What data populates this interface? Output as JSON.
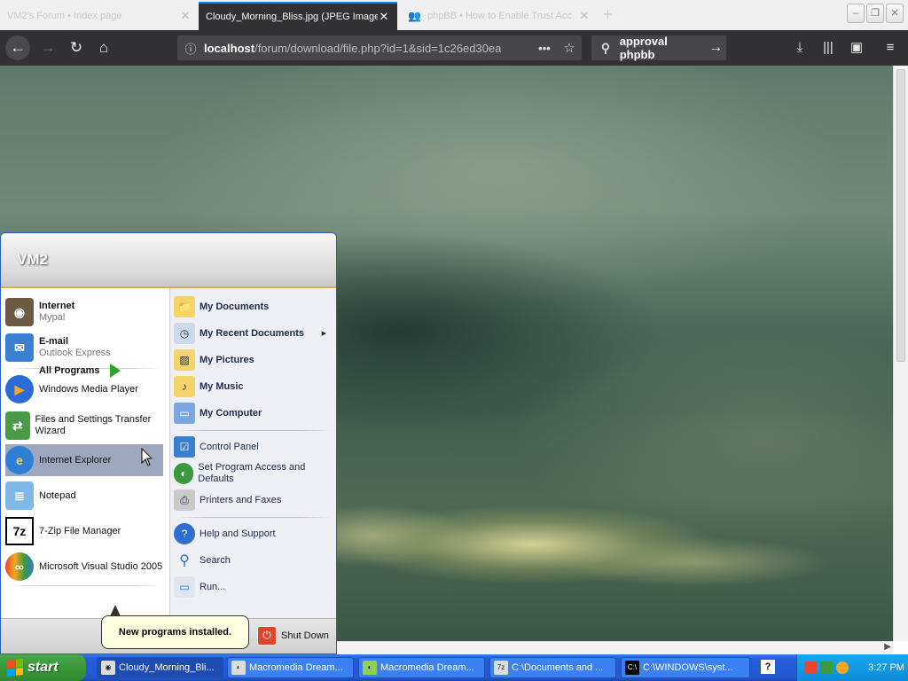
{
  "browser": {
    "tabs": [
      {
        "title": "VM2's Forum • Index page",
        "active": false
      },
      {
        "title": "Cloudy_Morning_Bliss.jpg (JPEG Image",
        "active": true
      },
      {
        "title": "phpBB • How to Enable Trust Acc",
        "active": false
      }
    ],
    "url_host": "localhost",
    "url_path": "/forum/download/file.php?id=1&sid=1c26ed30ea",
    "search_text": "approval phpbb"
  },
  "start_menu": {
    "user_name": "VM2",
    "pinned": [
      {
        "title": "Internet",
        "subtitle": "Mypal"
      },
      {
        "title": "E-mail",
        "subtitle": "Outlook Express"
      }
    ],
    "recent": [
      {
        "label": "Windows Media Player"
      },
      {
        "label": "Files and Settings Transfer Wizard"
      },
      {
        "label": "Internet Explorer"
      },
      {
        "label": "Notepad"
      },
      {
        "label": "7-Zip File Manager"
      },
      {
        "label": "Microsoft Visual Studio 2005"
      }
    ],
    "all_programs": "All Programs",
    "places": [
      {
        "label": "My Documents"
      },
      {
        "label": "My Recent Documents"
      },
      {
        "label": "My Pictures"
      },
      {
        "label": "My Music"
      },
      {
        "label": "My Computer"
      }
    ],
    "system": [
      {
        "label": "Control Panel"
      },
      {
        "label": "Set Program Access and Defaults"
      },
      {
        "label": "Printers and Faxes"
      }
    ],
    "help": [
      {
        "label": "Help and Support"
      },
      {
        "label": "Search"
      },
      {
        "label": "Run..."
      }
    ],
    "shutdown": "Shut Down",
    "balloon": "New programs installed."
  },
  "taskbar": {
    "start_label": "start",
    "tasks": [
      {
        "label": "Cloudy_Morning_Bli..."
      },
      {
        "label": "Macromedia Dream..."
      },
      {
        "label": "Macromedia Dream..."
      },
      {
        "label": "C:\\Documents and ..."
      },
      {
        "label": "C:\\WINDOWS\\syst..."
      }
    ],
    "help_tray": "?",
    "clock": "3:27 PM"
  },
  "colors": {
    "xp_blue": "#245edb",
    "start_green": "#3c9a3c",
    "firefox_dark": "#323234",
    "tray_blue": "#0f8bd8"
  }
}
